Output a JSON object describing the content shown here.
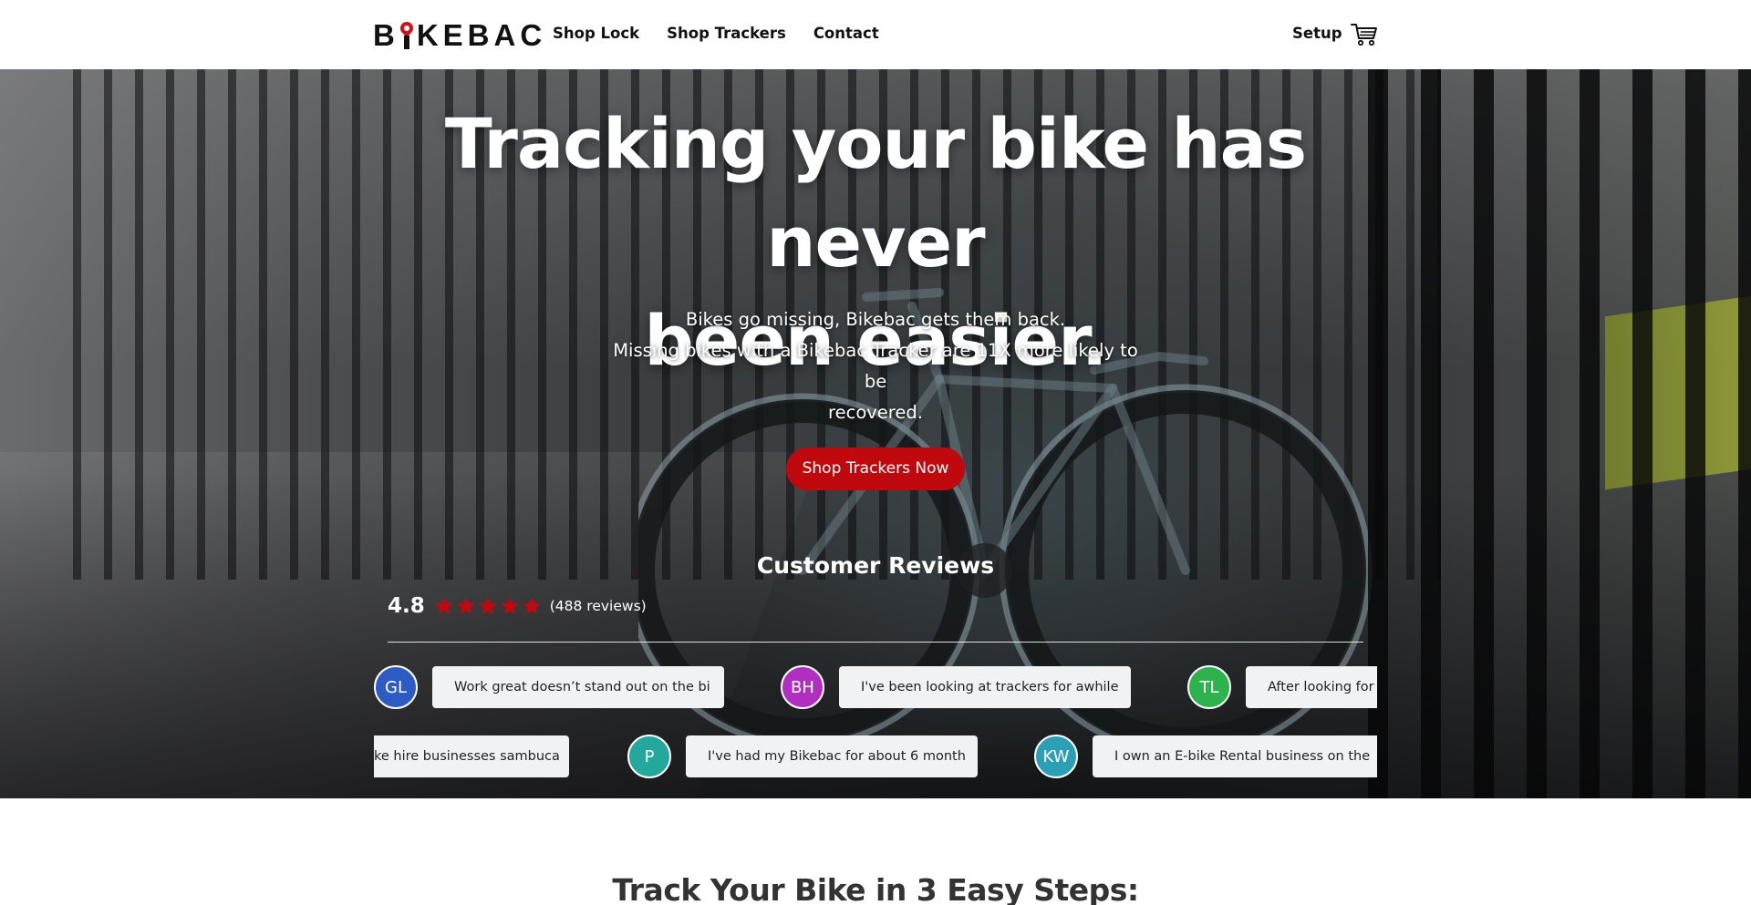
{
  "brand": {
    "logo_text_a": "B",
    "logo_text_b": "KEBAC",
    "accent_color": "#c0090f"
  },
  "nav": {
    "left": [
      "Shop Lock",
      "Shop Trackers",
      "Contact"
    ],
    "setup": "Setup",
    "cart_icon": "shopping-cart-icon"
  },
  "hero": {
    "title_line1": "Tracking your bike has never",
    "title_line2": "been easier.",
    "sub_line1": "Bikes go missing, Bikebac gets them back.",
    "sub_line2": "Missing bikes with a Bikebac Tracker are 11X more likely to be",
    "sub_line3": "recovered.",
    "cta": "Shop Trackers Now"
  },
  "reviews": {
    "title": "Customer Reviews",
    "score": "4.8",
    "star_count": 5,
    "count": "(488 reviews)",
    "row1": [
      {
        "initials": "GL",
        "color": "#2d5bc4",
        "text": "Work great doesn’t stand out on the bi"
      },
      {
        "initials": "BH",
        "color": "#b02fc0",
        "text": "I've been looking at trackers for awhile"
      },
      {
        "initials": "TL",
        "color": "#2eb24e",
        "text": "After looking for s"
      }
    ],
    "row2": [
      {
        "initials": "",
        "color": "#2aa9a0",
        "text": "ke hire businesses sambuca"
      },
      {
        "initials": "P",
        "color": "#23a89b",
        "text": "I've had my Bikebac for about 6 month"
      },
      {
        "initials": "KW",
        "color": "#2a9fb6",
        "text": "I own an E-bike Rental business on the"
      }
    ]
  },
  "steps": {
    "title": "Track Your Bike in 3 Easy Steps:"
  }
}
